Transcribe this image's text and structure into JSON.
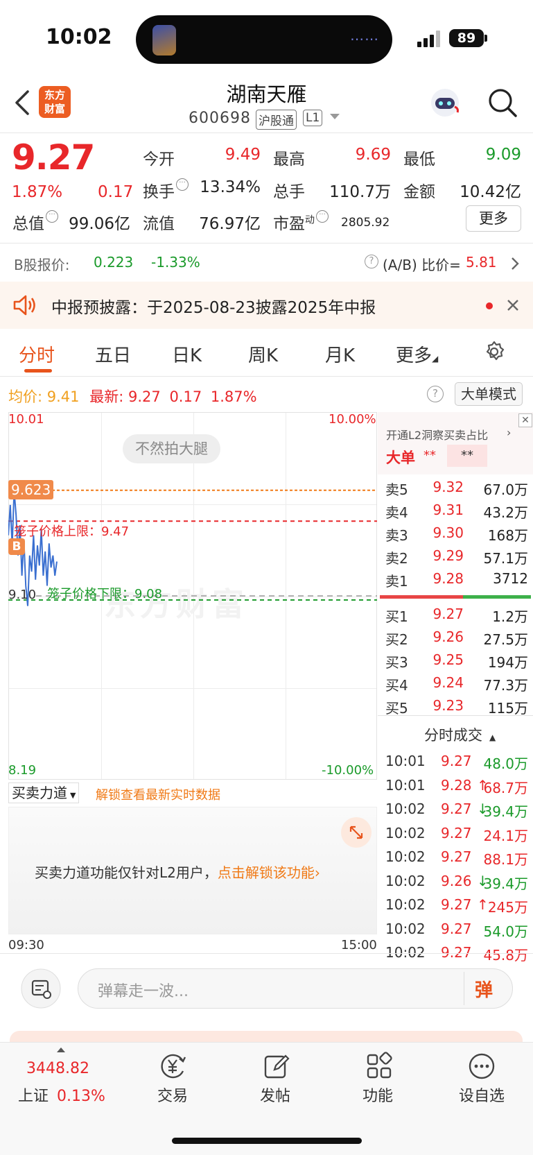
{
  "status_bar": {
    "time": "10:02",
    "battery": "89"
  },
  "header": {
    "logo_line1": "东方",
    "logo_line2": "财富",
    "stock_name": "湖南天雁",
    "stock_code": "600698",
    "tag_market": "沪股通",
    "tag_level": "L1"
  },
  "quote": {
    "price": "9.27",
    "pct_change": "1.87%",
    "abs_change": "0.17",
    "open_label": "今开",
    "open": "9.49",
    "high_label": "最高",
    "high": "9.69",
    "low_label": "最低",
    "low": "9.09",
    "turnover_label": "换手",
    "turnover": "13.34%",
    "volume_label": "总手",
    "volume": "110.7万",
    "amount_label": "金额",
    "amount": "10.42亿",
    "mktcap_label": "总值",
    "mktcap": "99.06亿",
    "float_label": "流值",
    "float": "76.97亿",
    "pe_label": "市盈",
    "pe_sup": "动",
    "pe": "2805.92",
    "more_label": "更多"
  },
  "bshare": {
    "label": "B股报价:",
    "price": "0.223",
    "change": "-1.33%",
    "ratio_label": "(A/B) 比价=",
    "ratio": "5.81"
  },
  "notice": {
    "text": "中报预披露：于2025-08-23披露2025年中报"
  },
  "tabs": [
    "分时",
    "五日",
    "日K",
    "周K",
    "月K",
    "更多"
  ],
  "chart_header": {
    "avg_label": "均价:",
    "avg": "9.41",
    "latest_label": "最新:",
    "latest": "9.27",
    "change": "0.17",
    "pct": "1.87%",
    "mode_button": "大单模式"
  },
  "chart": {
    "y_top": "10.01",
    "y_top_pct": "10.00%",
    "y_bottom": "8.19",
    "y_bottom_pct": "-10.00%",
    "danmu_bubble": "不然拍大腿",
    "high_tag": "9.623",
    "cage_upper": "笼子价格上限：9.47",
    "cage_lower": "笼子价格下限：9.08",
    "low_tick": "9.10",
    "b_marker": "B",
    "watermark": "东方财富",
    "x_start": "09:30",
    "x_end": "15:00"
  },
  "chart_data": {
    "type": "line",
    "title": "",
    "xlabel": "",
    "ylabel": "",
    "ylim": [
      8.19,
      10.01
    ],
    "x_range": [
      "09:30",
      "15:00"
    ],
    "reference_lines": [
      {
        "label": "笼子价格上限",
        "value": 9.47
      },
      {
        "label": "笼子价格下限",
        "value": 9.08
      },
      {
        "label": "9.623",
        "value": 9.623
      }
    ],
    "series": [
      {
        "values": [
          9.4,
          9.55,
          9.35,
          9.62,
          9.5,
          9.3,
          9.45,
          9.2,
          9.38,
          9.15,
          9.05,
          9.3,
          9.22,
          9.4,
          9.18,
          9.35,
          9.25,
          9.43,
          9.2,
          9.32,
          9.15,
          9.36,
          9.24,
          9.3,
          9.2,
          9.27
        ]
      }
    ]
  },
  "level2": {
    "promo": "开通L2洞察买卖占比",
    "big_order_label": "大单",
    "stars1": "**",
    "stars2": "**"
  },
  "order_book": {
    "asks": [
      {
        "label": "卖5",
        "price": "9.32",
        "vol": "67.0万"
      },
      {
        "label": "卖4",
        "price": "9.31",
        "vol": "43.2万"
      },
      {
        "label": "卖3",
        "price": "9.30",
        "vol": "168万"
      },
      {
        "label": "卖2",
        "price": "9.29",
        "vol": "57.1万"
      },
      {
        "label": "卖1",
        "price": "9.28",
        "vol": "3712"
      }
    ],
    "bids": [
      {
        "label": "买1",
        "price": "9.27",
        "vol": "1.2万"
      },
      {
        "label": "买2",
        "price": "9.26",
        "vol": "27.5万"
      },
      {
        "label": "买3",
        "price": "9.25",
        "vol": "194万"
      },
      {
        "label": "买4",
        "price": "9.24",
        "vol": "77.3万"
      },
      {
        "label": "买5",
        "price": "9.23",
        "vol": "115万"
      }
    ]
  },
  "trades": {
    "title": "分时成交",
    "rows": [
      {
        "time": "10:01",
        "price": "9.27",
        "arrow": "",
        "vol": "48.0万"
      },
      {
        "time": "10:01",
        "price": "9.28",
        "arrow": "↑",
        "vol": "68.7万"
      },
      {
        "time": "10:02",
        "price": "9.27",
        "arrow": "↓",
        "vol": "39.4万"
      },
      {
        "time": "10:02",
        "price": "9.27",
        "arrow": "",
        "vol": "24.1万"
      },
      {
        "time": "10:02",
        "price": "9.27",
        "arrow": "",
        "vol": "88.1万"
      },
      {
        "time": "10:02",
        "price": "9.26",
        "arrow": "↓",
        "vol": "39.4万"
      },
      {
        "time": "10:02",
        "price": "9.27",
        "arrow": "↑",
        "vol": "245万"
      },
      {
        "time": "10:02",
        "price": "9.27",
        "arrow": "",
        "vol": "54.0万"
      },
      {
        "time": "10:02",
        "price": "9.27",
        "arrow": "",
        "vol": "45.8万"
      }
    ]
  },
  "force": {
    "dropdown": "买卖力道",
    "unlock_link": "解锁查看最新实时数据",
    "message": "买卖力道功能仅针对L2用户，",
    "message_link": "点击解锁该功能"
  },
  "danmu": {
    "placeholder": "弹幕走一波...",
    "button": "弹"
  },
  "bottom_nav": {
    "index_value": "3448.82",
    "index_name": "上证",
    "index_change": "0.13%",
    "items": [
      "交易",
      "发帖",
      "功能",
      "设自选"
    ]
  },
  "colors": {
    "up": "#e8272a",
    "down": "#1a9a2a",
    "accent": "#e8541c",
    "line": "#3a6fd0"
  }
}
